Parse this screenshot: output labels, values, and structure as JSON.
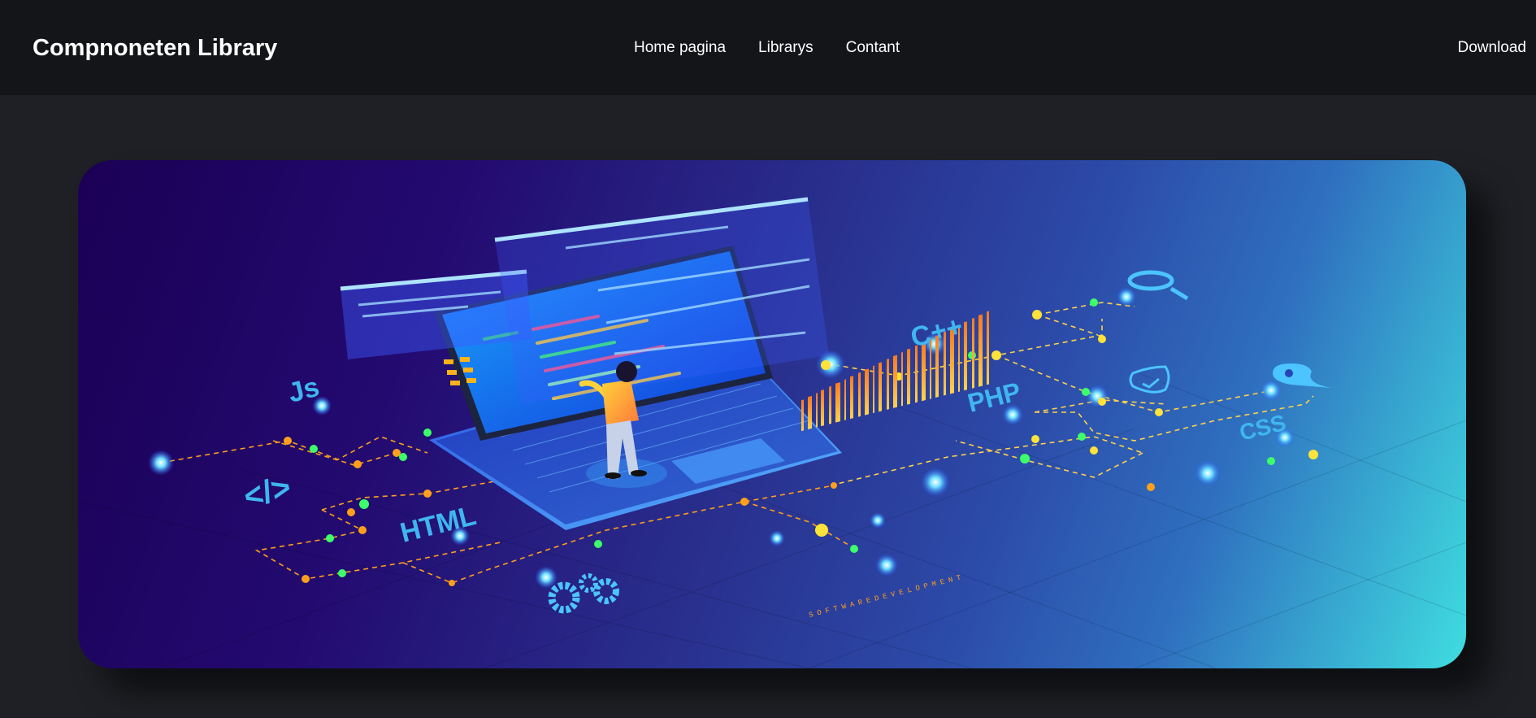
{
  "navbar": {
    "brand": "Compnoneten Library",
    "links": [
      {
        "label": "Home pagina"
      },
      {
        "label": "Librarys"
      },
      {
        "label": "Contant"
      }
    ],
    "download_label": "Download"
  },
  "hero": {
    "labels": {
      "js": "Js",
      "code_tag": "</>",
      "html": "HTML",
      "cpp": "C++",
      "php": "PHP",
      "css": "CSS",
      "barcode": "SOFTWAREDEVELOPMENT"
    },
    "colors": {
      "label": "#3fb6f0",
      "node_orange": "#ff9f1c",
      "node_green": "#3dff6a",
      "node_yellow": "#ffe23a",
      "node_blue": "#5ad2ff"
    }
  }
}
